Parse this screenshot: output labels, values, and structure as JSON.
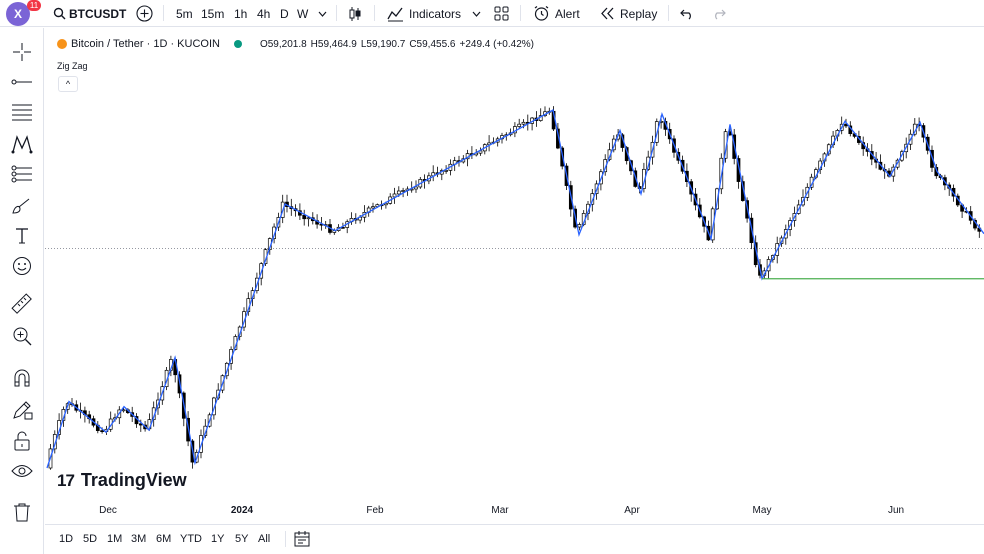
{
  "topbar": {
    "avatar_letter": "X",
    "notification_count": "11",
    "symbol": "BTCUSDT",
    "intervals": [
      "5m",
      "15m",
      "1h",
      "4h",
      "D",
      "W"
    ],
    "active_interval": "D",
    "indicators_label": "Indicators",
    "alert_label": "Alert",
    "replay_label": "Replay"
  },
  "chart": {
    "title": "Bitcoin / Tether · 1D · KUCOIN",
    "ohlc": {
      "open": "O59,201.8",
      "high": "H59,464.9",
      "low": "L59,190.7",
      "close": "C59,455.6",
      "change": "+249.4 (+0.42%)"
    },
    "indicator": "Zig Zag",
    "collapse_icon_label": "^",
    "logo_text": "TradingView",
    "x_labels": [
      "Dec",
      "2024",
      "Feb",
      "Mar",
      "Apr",
      "May",
      "Jun"
    ],
    "colors": {
      "up": "#ffffff",
      "down": "#000000",
      "zigzag": "#2962ff",
      "support": "#4caf50",
      "dotted": "#9598a1"
    }
  },
  "chart_data": {
    "type": "candlestick",
    "title": "Bitcoin / Tether · 1D · KUCOIN",
    "x": [
      "Dec",
      "2024",
      "Feb",
      "Mar",
      "Apr",
      "May",
      "Jun"
    ],
    "zigzag_pivots_usd": [
      38000,
      44500,
      41500,
      44000,
      41700,
      48800,
      38500,
      63800,
      61200,
      73000,
      60800,
      71000,
      64800,
      72600,
      60400,
      71600,
      56500,
      71900,
      66500,
      71800,
      67000,
      60900
    ],
    "support_level_usd": 56500,
    "dotted_level_usd": 59455.6,
    "last_close_usd": 59455.6
  },
  "bottombar": {
    "ranges": [
      "1D",
      "5D",
      "1M",
      "3M",
      "6M",
      "YTD",
      "1Y",
      "5Y",
      "All"
    ]
  }
}
